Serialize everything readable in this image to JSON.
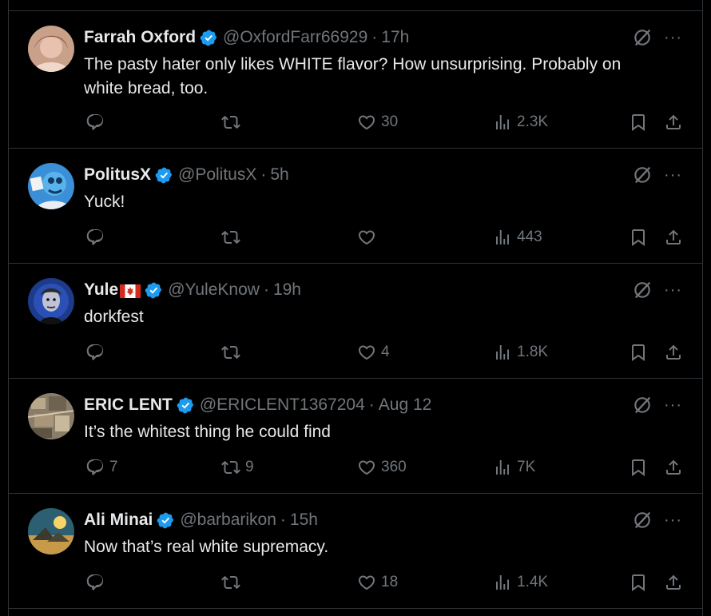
{
  "colors": {
    "background": "#000000",
    "text_primary": "#e7e9ea",
    "text_secondary": "#71767b",
    "divider": "#2f3336",
    "verified_badge": "#1d9bf0"
  },
  "icons": {
    "reply": "reply-icon",
    "repost": "repost-icon",
    "like": "like-icon",
    "views": "views-icon",
    "bookmark": "bookmark-icon",
    "share": "share-icon",
    "grok": "grok-icon",
    "more": "more-icon",
    "verified": "verified-badge-icon"
  },
  "more_label": "···",
  "tweets": [
    {
      "name": "Farrah Oxford",
      "handle": "@OxfordFarr66929",
      "separator": "·",
      "time": "17h",
      "text": "The pasty hater only likes WHITE flavor? How unsurprising. Probably on white bread, too.",
      "replies": "",
      "reposts": "",
      "likes": "30",
      "views": "2.3K"
    },
    {
      "name": "PolitusX",
      "handle": "@PolitusX",
      "separator": "·",
      "time": "5h",
      "text": "Yuck!",
      "replies": "",
      "reposts": "",
      "likes": "",
      "views": "443"
    },
    {
      "name": "Yule",
      "flag": "canada-flag",
      "handle": "@YuleKnow",
      "separator": "·",
      "time": "19h",
      "text": "dorkfest",
      "replies": "",
      "reposts": "",
      "likes": "4",
      "views": "1.8K"
    },
    {
      "name": "ERIC LENT",
      "handle": "@ERICLENT1367204",
      "separator": "·",
      "time": "Aug 12",
      "text": "It’s the whitest thing he could find",
      "replies": "7",
      "reposts": "9",
      "likes": "360",
      "views": "7K"
    },
    {
      "name": "Ali Minai",
      "handle": "@barbarikon",
      "separator": "·",
      "time": "15h",
      "text": "Now that’s real white supremacy.",
      "replies": "",
      "reposts": "",
      "likes": "18",
      "views": "1.4K"
    }
  ]
}
